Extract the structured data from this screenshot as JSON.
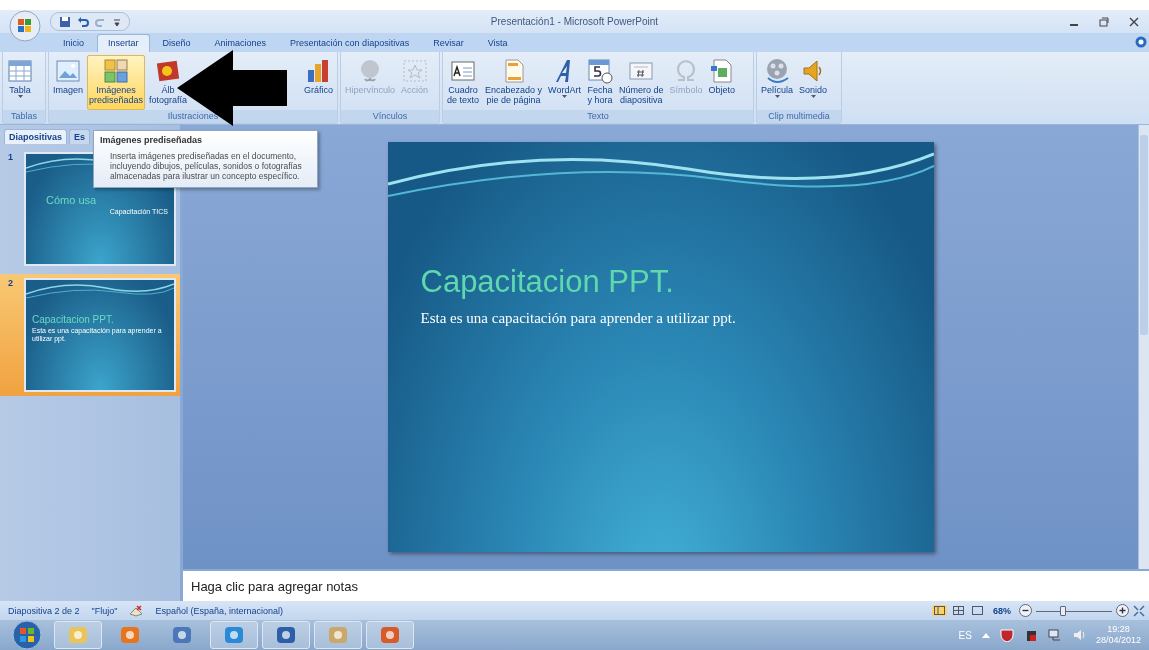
{
  "window": {
    "title": "Presentación1 - Microsoft PowerPoint"
  },
  "ribbon_tabs": [
    {
      "label": "Inicio",
      "selected": false
    },
    {
      "label": "Insertar",
      "selected": true
    },
    {
      "label": "Diseño",
      "selected": false
    },
    {
      "label": "Animaciones",
      "selected": false
    },
    {
      "label": "Presentación con diapositivas",
      "selected": false
    },
    {
      "label": "Revisar",
      "selected": false
    },
    {
      "label": "Vista",
      "selected": false
    }
  ],
  "ribbon_groups": [
    {
      "label": "Tablas",
      "buttons": [
        {
          "lines": [
            "Tabla"
          ],
          "dropdown": true,
          "hovered": false,
          "disabled": false
        }
      ]
    },
    {
      "label": "Ilustraciones",
      "buttons": [
        {
          "lines": [
            "Imagen"
          ],
          "dropdown": false,
          "hovered": false,
          "disabled": false
        },
        {
          "lines": [
            "Imágenes",
            "prediseñadas"
          ],
          "dropdown": false,
          "hovered": true,
          "disabled": false
        },
        {
          "lines": [
            "Álb",
            "fotografía"
          ],
          "dropdown": false,
          "hovered": false,
          "disabled": false
        },
        {
          "lines": [
            "Gráfico"
          ],
          "dropdown": false,
          "hovered": false,
          "disabled": false
        }
      ]
    },
    {
      "label": "Vínculos",
      "buttons": [
        {
          "lines": [
            "Hipervínculo"
          ],
          "dropdown": false,
          "hovered": false,
          "disabled": true
        },
        {
          "lines": [
            "Acción"
          ],
          "dropdown": false,
          "hovered": false,
          "disabled": true
        }
      ]
    },
    {
      "label": "Texto",
      "buttons": [
        {
          "lines": [
            "Cuadro",
            "de texto"
          ],
          "dropdown": false,
          "hovered": false,
          "disabled": false
        },
        {
          "lines": [
            "Encabezado y",
            "pie de página"
          ],
          "dropdown": false,
          "hovered": false,
          "disabled": false
        },
        {
          "lines": [
            "WordArt"
          ],
          "dropdown": true,
          "hovered": false,
          "disabled": false
        },
        {
          "lines": [
            "Fecha",
            "y hora"
          ],
          "dropdown": false,
          "hovered": false,
          "disabled": false
        },
        {
          "lines": [
            "Número de",
            "diapositiva"
          ],
          "dropdown": false,
          "hovered": false,
          "disabled": false
        },
        {
          "lines": [
            "Símbolo"
          ],
          "dropdown": false,
          "hovered": false,
          "disabled": true
        },
        {
          "lines": [
            "Objeto"
          ],
          "dropdown": false,
          "hovered": false,
          "disabled": false
        }
      ]
    },
    {
      "label": "Clip multimedia",
      "buttons": [
        {
          "lines": [
            "Película"
          ],
          "dropdown": true,
          "hovered": false,
          "disabled": false
        },
        {
          "lines": [
            "Sonido"
          ],
          "dropdown": true,
          "hovered": false,
          "disabled": false
        }
      ]
    }
  ],
  "tooltip": {
    "title": "Imágenes prediseñadas",
    "text": "Inserta imágenes prediseñadas en el documento, incluyendo dibujos, películas, sonidos o fotografías almacenadas para ilustrar un concepto específico."
  },
  "pane_tabs": [
    {
      "label": "Diapositivas",
      "selected": true
    },
    {
      "label": "Es",
      "selected": false
    }
  ],
  "slides": [
    {
      "number": "1",
      "title": "Cómo usa",
      "subtitle": "Capacitación TICS",
      "selected": false
    },
    {
      "number": "2",
      "title": "Capacitacion PPT.",
      "subtitle": "Esta es una capacitación para aprender a utilizar ppt.",
      "selected": true
    }
  ],
  "current_slide": {
    "title": "Capacitacion PPT.",
    "subtitle": "Esta es una capacitación para aprender a utilizar ppt."
  },
  "notes": {
    "text": "Haga clic para agregar notas"
  },
  "status_bar": {
    "slide": "Diapositiva 2 de 2",
    "theme": "\"Flujo\"",
    "language": "Español (España, internacional)",
    "views": [
      {
        "selected": true
      },
      {
        "selected": false
      },
      {
        "selected": false
      }
    ],
    "zoom": "68%",
    "zoom_slider": {
      "level": 0.36
    }
  },
  "taskbar": {
    "items": [
      {
        "running": true
      },
      {
        "running": false
      },
      {
        "running": false
      },
      {
        "running": true
      },
      {
        "running": true
      },
      {
        "running": true
      },
      {
        "running": true
      }
    ],
    "language": "ES",
    "time": "19:28",
    "date": "28/04/2012"
  }
}
